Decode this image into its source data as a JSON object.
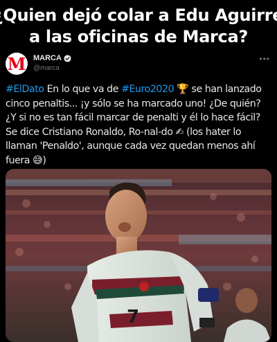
{
  "meme": {
    "title_lines": [
      "¿Quien dejó colar a Edu Aguirre",
      "a las oficinas de Marca?"
    ]
  },
  "tweet": {
    "author": {
      "name": "MARCA",
      "handle": "@marca",
      "avatar_letter": "M",
      "verified": true
    },
    "more_label": "•••",
    "lines": [
      {
        "parts": [
          {
            "kind": "hashtag",
            "text": "#ElDato"
          },
          {
            "kind": "text",
            "text": " En lo que va de "
          },
          {
            "kind": "hashtag",
            "text": "#Euro2020"
          },
          {
            "kind": "text",
            "text": " 🏆 se han lanzado"
          }
        ]
      },
      {
        "parts": [
          {
            "kind": "text",
            "text": "cinco penaltis... ¡y sólo se ha marcado uno! ¿De quién?"
          }
        ]
      },
      {
        "parts": [
          {
            "kind": "text",
            "text": "¿Y si no es tan fácil marcar de penalti y él lo hace fácil?"
          }
        ]
      },
      {
        "parts": [
          {
            "kind": "text",
            "text": "Se dice Cristiano Ronaldo, Ro-nal-do ✍ (los hater lo"
          }
        ]
      },
      {
        "parts": [
          {
            "kind": "text",
            "text": "llaman 'Penaldo', aunque cada vez quedan menos ahí"
          }
        ]
      },
      {
        "parts": [
          {
            "kind": "text",
            "text": "fuera 😅)"
          }
        ]
      }
    ],
    "media": {
      "description_icon": "football-player-photo",
      "jersey_number": "7"
    }
  },
  "colors": {
    "background": "#000000",
    "text": "#e7e9ea",
    "hashtag": "#1d9bf0",
    "handle": "#71767b",
    "brand_red": "#e2001a"
  }
}
